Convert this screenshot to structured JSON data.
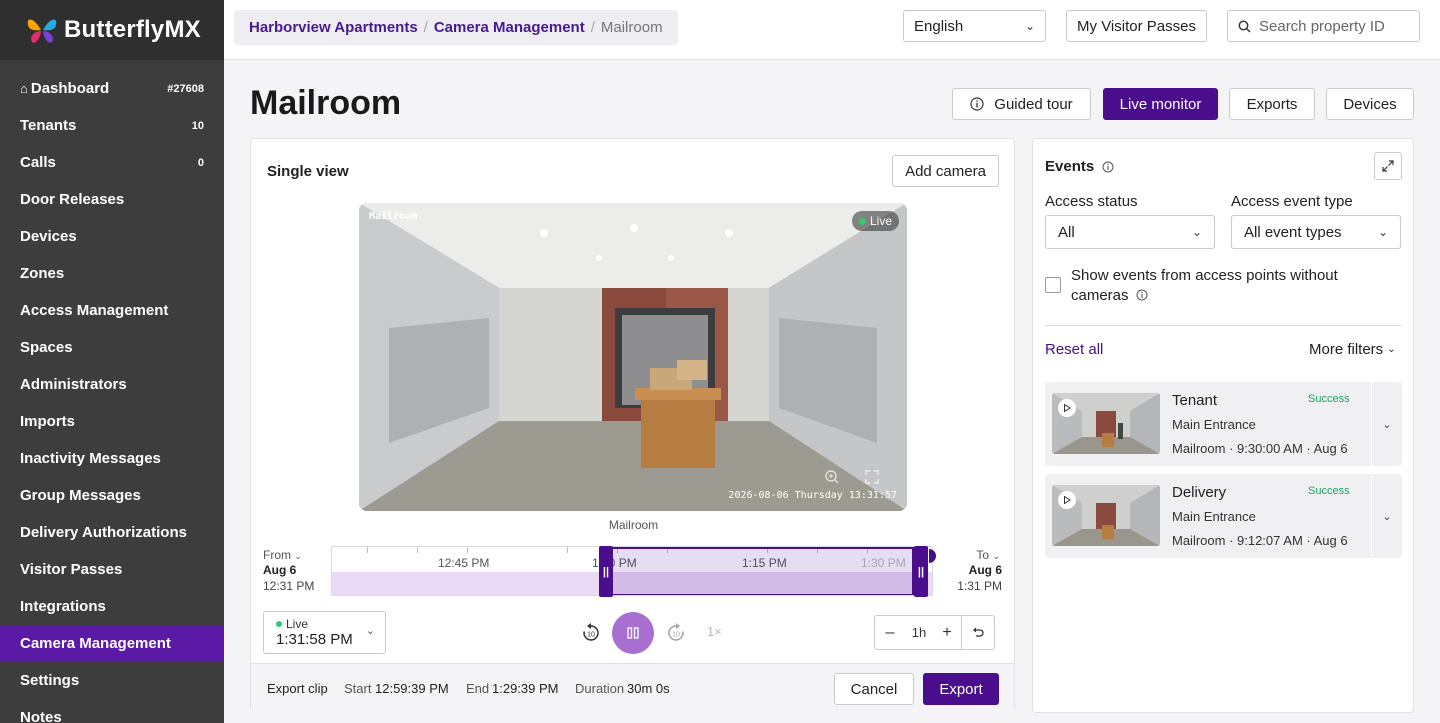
{
  "brand": {
    "name": "ButterflyMX"
  },
  "sidebar": {
    "items": [
      {
        "label": "Dashboard",
        "count": "#27608",
        "icon": "home-icon"
      },
      {
        "label": "Tenants",
        "count": "10"
      },
      {
        "label": "Calls",
        "count": "0"
      },
      {
        "label": "Door Releases"
      },
      {
        "label": "Devices"
      },
      {
        "label": "Zones"
      },
      {
        "label": "Access Management"
      },
      {
        "label": "Spaces"
      },
      {
        "label": "Administrators"
      },
      {
        "label": "Imports"
      },
      {
        "label": "Inactivity Messages"
      },
      {
        "label": "Group Messages"
      },
      {
        "label": "Delivery Authorizations"
      },
      {
        "label": "Visitor Passes"
      },
      {
        "label": "Integrations"
      },
      {
        "label": "Camera Management",
        "active": true
      },
      {
        "label": "Settings"
      },
      {
        "label": "Notes"
      }
    ]
  },
  "breadcrumb": {
    "home": "Harborview Apartments",
    "section": "Camera Management",
    "current": "Mailroom"
  },
  "topbar": {
    "language": "English",
    "visitor_passes": "My Visitor Passes",
    "search_placeholder": "Search property ID"
  },
  "page": {
    "title": "Mailroom",
    "actions": {
      "guided_tour": "Guided tour",
      "live_monitor": "Live monitor",
      "exports": "Exports",
      "devices": "Devices"
    }
  },
  "video": {
    "view_label": "Single view",
    "add_camera": "Add camera",
    "camera_osd_name": "Mailroom",
    "live_badge": "Live",
    "timestamp": "2026-08-06 Thursday 13:31:57",
    "caption": "Mailroom",
    "timeline": {
      "from_label": "From",
      "from_date": "Aug 6",
      "from_time": "12:31 PM",
      "to_label": "To",
      "to_date": "Aug 6",
      "to_time": "1:31 PM",
      "ticks": [
        "12:45 PM",
        "1:00 PM",
        "1:15 PM",
        "1:30 PM"
      ]
    },
    "live_status": "Live",
    "live_time": "1:31:58 PM",
    "speed": "1×",
    "zoom": "1h"
  },
  "export": {
    "label": "Export clip",
    "start_label": "Start",
    "start": "12:59:39 PM",
    "end_label": "End",
    "end": "1:29:39 PM",
    "duration_label": "Duration",
    "duration": "30m 0s",
    "cancel": "Cancel",
    "export": "Export"
  },
  "events": {
    "title": "Events",
    "access_status_label": "Access status",
    "access_status_value": "All",
    "event_type_label": "Access event type",
    "event_type_value": "All event types",
    "checkbox_label": "Show events from access points without cameras",
    "reset": "Reset all",
    "more_filters": "More filters",
    "items": [
      {
        "title": "Tenant",
        "status": "Success",
        "entrance": "Main Entrance",
        "meta": "Mailroom · 9:30:00 AM · Aug 6"
      },
      {
        "title": "Delivery",
        "status": "Success",
        "entrance": "Main Entrance",
        "meta": "Mailroom · 9:12:07 AM · Aug 6"
      }
    ]
  },
  "colors": {
    "brand_purple": "#4a0d8c",
    "sidebar_bg": "#3d3d3d",
    "success": "#20a060"
  }
}
